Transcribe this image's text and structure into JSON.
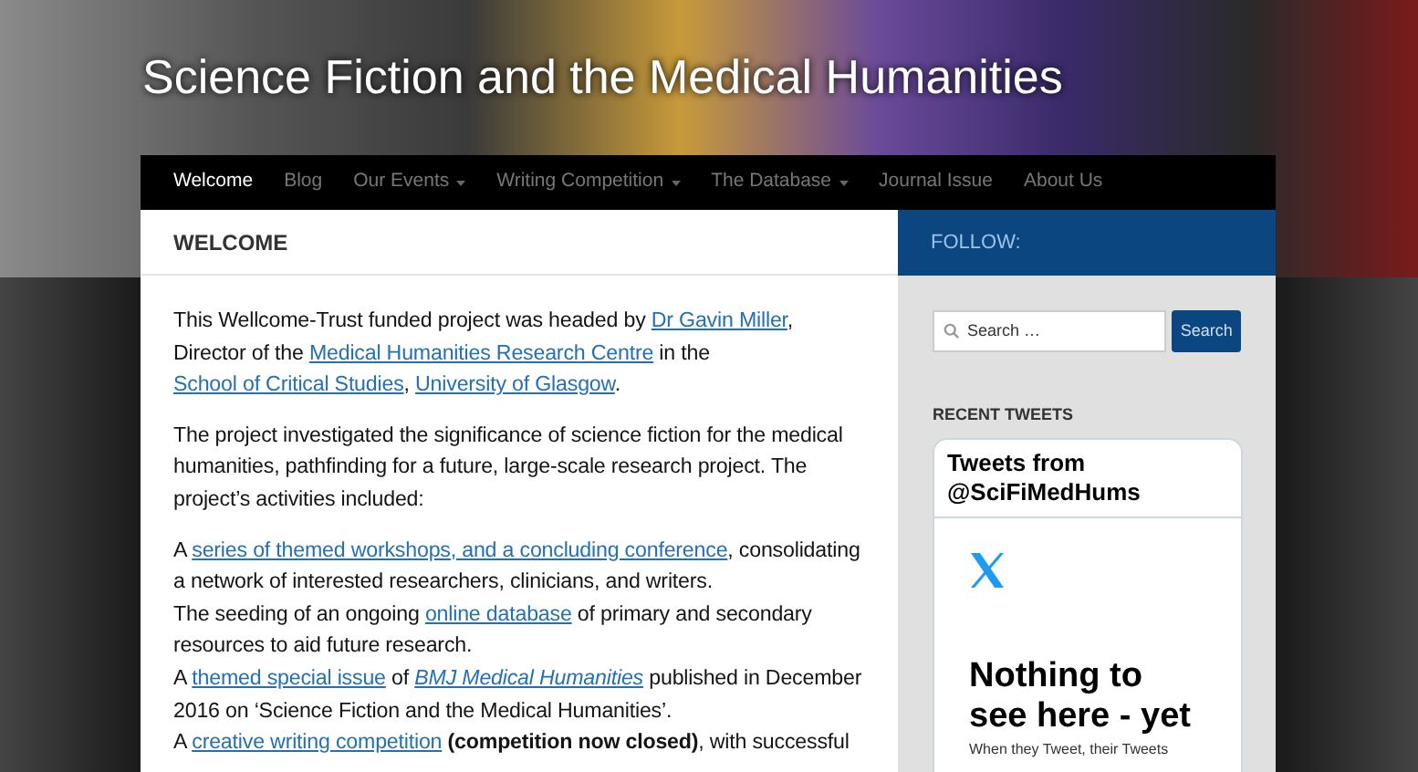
{
  "site_title": "Science Fiction and the Medical Humanities",
  "nav": [
    {
      "label": "Welcome",
      "selected": true,
      "has_submenu": false
    },
    {
      "label": "Blog",
      "selected": false,
      "has_submenu": false
    },
    {
      "label": "Our Events",
      "selected": false,
      "has_submenu": true
    },
    {
      "label": "Writing Competition",
      "selected": false,
      "has_submenu": true
    },
    {
      "label": "The Database",
      "selected": false,
      "has_submenu": true
    },
    {
      "label": "Journal Issue",
      "selected": false,
      "has_submenu": false
    },
    {
      "label": "About Us",
      "selected": false,
      "has_submenu": false
    }
  ],
  "page_title": "WELCOME",
  "paragraphs": [
    [
      {
        "kind": "text",
        "text": "This Wellcome-Trust funded project was headed by "
      },
      {
        "kind": "link",
        "text": "Dr Gavin Miller"
      },
      {
        "kind": "text",
        "text": ", Director of the "
      },
      {
        "kind": "link",
        "text": "Medical Humanities Research Centre"
      },
      {
        "kind": "text",
        "text": " in the "
      },
      {
        "kind": "link",
        "text": "School of Critical Studies"
      },
      {
        "kind": "text",
        "text": ", "
      },
      {
        "kind": "link",
        "text": "University of Glasgow"
      },
      {
        "kind": "text",
        "text": "."
      }
    ],
    [
      {
        "kind": "text",
        "text": "The project investigated the significance of science fiction for the medical humanities, pathfinding for a future, large-scale research project. The project’s activities included:"
      }
    ],
    [
      {
        "kind": "text",
        "text": "A "
      },
      {
        "kind": "link",
        "text": "series of themed workshops, and a concluding conference"
      },
      {
        "kind": "text",
        "text": ", consolidating a network of interested researchers, clinicians, and writers."
      },
      {
        "kind": "break"
      },
      {
        "kind": "text",
        "text": "The seeding of an ongoing "
      },
      {
        "kind": "link",
        "text": "online database"
      },
      {
        "kind": "text",
        "text": " of primary and secondary resources to aid future research."
      },
      {
        "kind": "break"
      },
      {
        "kind": "text",
        "text": "A "
      },
      {
        "kind": "link",
        "text": "themed special issue"
      },
      {
        "kind": "text",
        "text": " of "
      },
      {
        "kind": "italic_link",
        "text": "BMJ Medical Humanities"
      },
      {
        "kind": "text",
        "text": " published in December 2016 on ‘Science Fiction and the Medical Humanities’."
      },
      {
        "kind": "break"
      },
      {
        "kind": "text",
        "text": "A "
      },
      {
        "kind": "link",
        "text": "creative writing competition"
      },
      {
        "kind": "bold",
        "text": " (competition now closed)"
      },
      {
        "kind": "text",
        "text": ", with successful"
      }
    ]
  ],
  "sidebar": {
    "title": "FOLLOW:",
    "search": {
      "placeholder": "Search …",
      "button": "Search"
    },
    "tweets": {
      "heading": "RECENT TWEETS",
      "card_title": "Tweets from @SciFiMedHums",
      "empty_title": "Nothing to see here - yet",
      "empty_text": "When they Tweet, their Tweets"
    }
  }
}
